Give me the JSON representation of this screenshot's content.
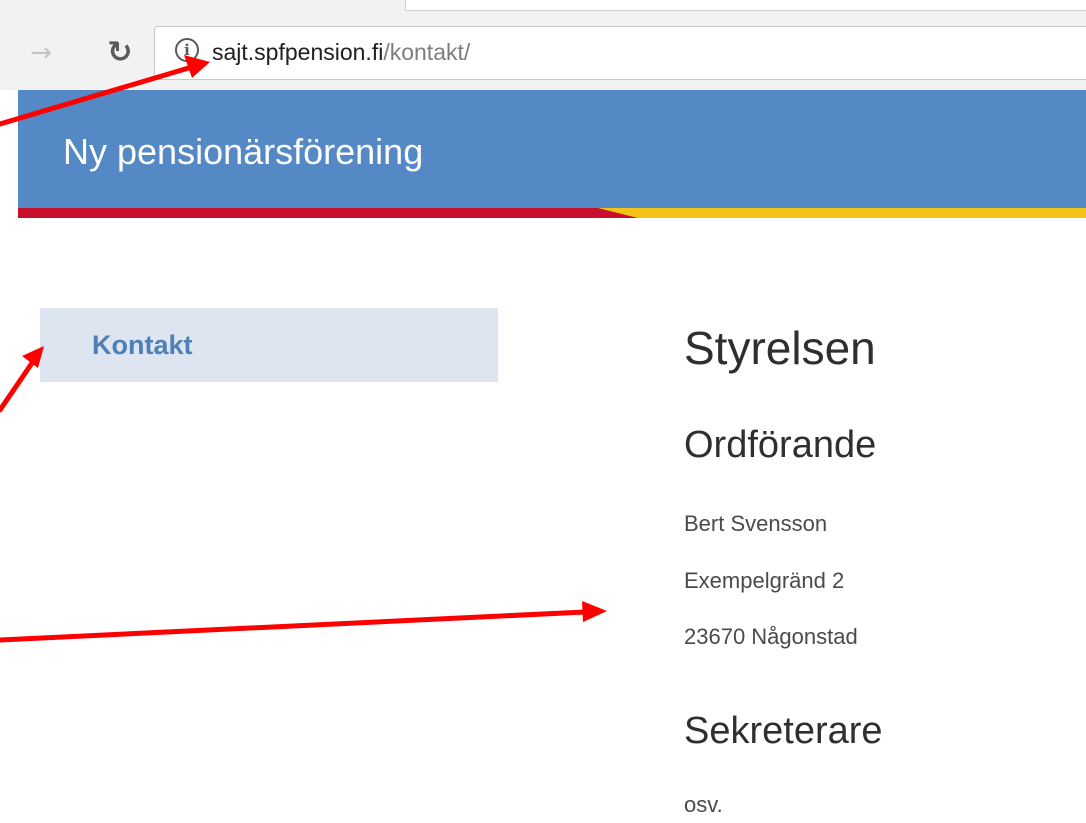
{
  "browser": {
    "url_host": "sajt.spfpension.fi",
    "url_path": "/kontakt/",
    "info_icon": "info-icon",
    "forward_icon": "arrow-right-icon",
    "reload_icon": "reload-icon"
  },
  "site": {
    "title": "Ny pensionärsförening",
    "header_color": "#5489c5",
    "stripe_colors": [
      "#c8102e",
      "#f3c318"
    ]
  },
  "sidebar": {
    "items": [
      {
        "label": "Kontakt",
        "active": true
      }
    ]
  },
  "main": {
    "heading": "Styrelsen",
    "sections": [
      {
        "heading": "Ordförande",
        "lines": [
          "Bert Svensson",
          "Exempelgränd 2",
          "23670 Någonstad"
        ]
      },
      {
        "heading": "Sekreterare",
        "lines": [
          "osv."
        ]
      }
    ]
  },
  "annotations": {
    "arrow_color": "#ff0000"
  }
}
